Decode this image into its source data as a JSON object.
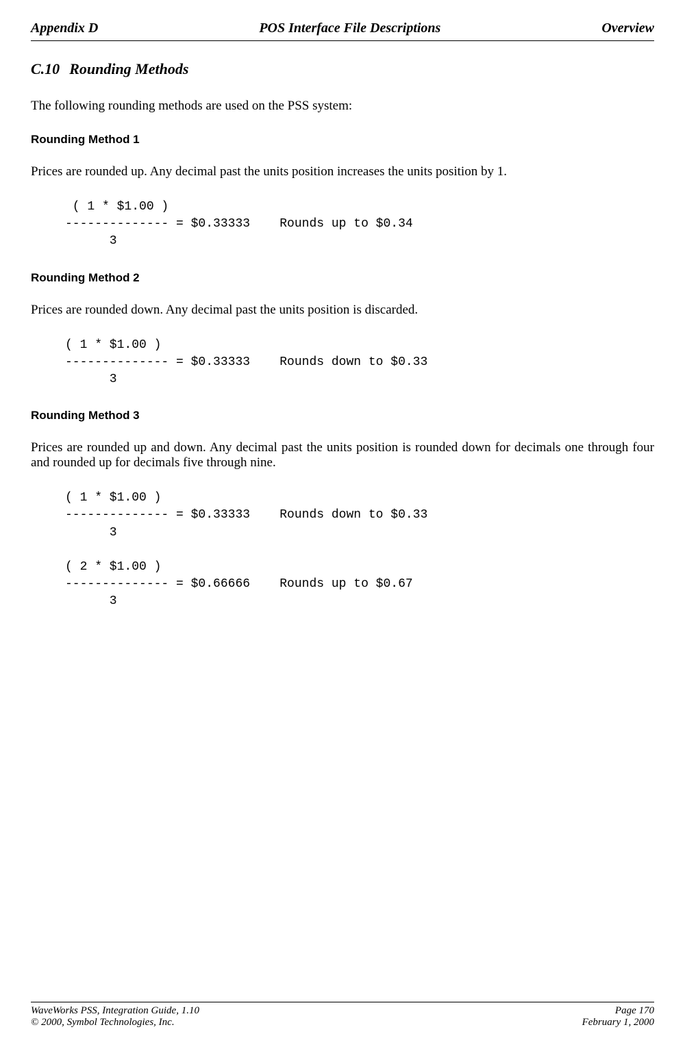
{
  "header": {
    "left": "Appendix D",
    "center": "POS Interface File Descriptions",
    "right": "Overview"
  },
  "title": {
    "number": "C.10",
    "text": "Rounding Methods"
  },
  "intro": "The following rounding methods are used on the PSS system:",
  "method1": {
    "heading": "Rounding Method 1",
    "desc": "Prices are rounded up.  Any decimal past the units position increases the units position by 1.",
    "code": " ( 1 * $1.00 )\n-------------- = $0.33333    Rounds up to $0.34\n      3"
  },
  "method2": {
    "heading": "Rounding Method 2",
    "desc": "Prices are rounded down.  Any decimal past the units position is discarded.",
    "code": "( 1 * $1.00 )\n-------------- = $0.33333    Rounds down to $0.33\n      3"
  },
  "method3": {
    "heading": "Rounding Method 3",
    "desc": "Prices are rounded up and down.  Any decimal past the units position is rounded down for decimals one through four and rounded up for decimals five through nine.",
    "code": "( 1 * $1.00 )\n-------------- = $0.33333    Rounds down to $0.33\n      3\n\n( 2 * $1.00 )\n-------------- = $0.66666    Rounds up to $0.67\n      3"
  },
  "footer": {
    "leftLine1": "WaveWorks PSS, Integration Guide, 1.10",
    "leftLine2": "© 2000, Symbol Technologies, Inc.",
    "rightLine1": "Page 170",
    "rightLine2": "February 1, 2000"
  }
}
